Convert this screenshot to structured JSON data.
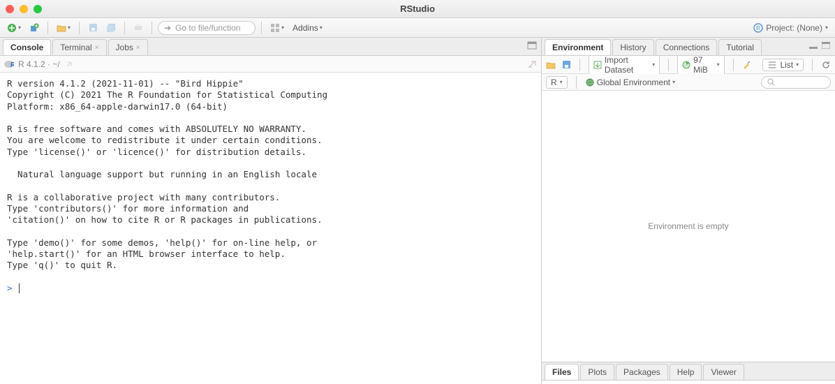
{
  "window": {
    "title": "RStudio"
  },
  "toolbar": {
    "goto_placeholder": "Go to file/function",
    "addins_label": "Addins",
    "project_label": "Project: (None)"
  },
  "left": {
    "tabs": [
      {
        "label": "Console"
      },
      {
        "label": "Terminal"
      },
      {
        "label": "Jobs"
      }
    ],
    "r_info": "R 4.1.2 · ~/",
    "console_text": "R version 4.1.2 (2021-11-01) -- \"Bird Hippie\"\nCopyright (C) 2021 The R Foundation for Statistical Computing\nPlatform: x86_64-apple-darwin17.0 (64-bit)\n\nR is free software and comes with ABSOLUTELY NO WARRANTY.\nYou are welcome to redistribute it under certain conditions.\nType 'license()' or 'licence()' for distribution details.\n\n  Natural language support but running in an English locale\n\nR is a collaborative project with many contributors.\nType 'contributors()' for more information and\n'citation()' on how to cite R or R packages in publications.\n\nType 'demo()' for some demos, 'help()' for on-line help, or\n'help.start()' for an HTML browser interface to help.\nType 'q()' to quit R.\n",
    "prompt": ">"
  },
  "right_top": {
    "tabs": [
      {
        "label": "Environment"
      },
      {
        "label": "History"
      },
      {
        "label": "Connections"
      },
      {
        "label": "Tutorial"
      }
    ],
    "import_label": "Import Dataset",
    "mem_label": "97 MiB",
    "view_label": "List",
    "lang_label": "R",
    "scope_label": "Global Environment",
    "empty_text": "Environment is empty"
  },
  "right_bottom": {
    "tabs": [
      {
        "label": "Files"
      },
      {
        "label": "Plots"
      },
      {
        "label": "Packages"
      },
      {
        "label": "Help"
      },
      {
        "label": "Viewer"
      }
    ]
  }
}
